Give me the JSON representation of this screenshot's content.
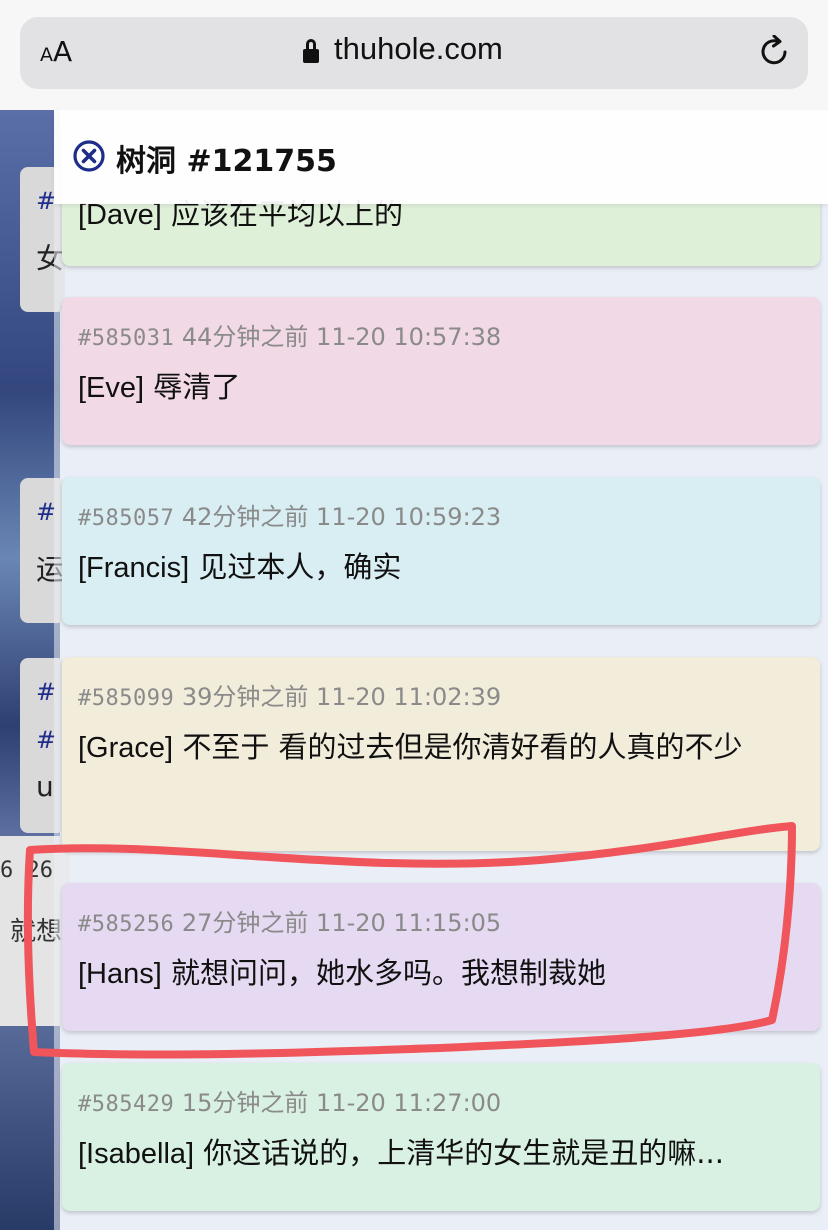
{
  "browser": {
    "text_size_label": "AA",
    "url": "thuhole.com"
  },
  "background_fragments": {
    "items": [
      "#",
      "女",
      "#",
      "运",
      "#",
      "#",
      "u",
      "6 26",
      "就想"
    ]
  },
  "panel": {
    "title": "树洞 #121755"
  },
  "replies": [
    {
      "id": "",
      "time_ago": "",
      "timestamp": "",
      "author": "[Dave]",
      "content": "应该在平均以上的",
      "color": "#dff0d9"
    },
    {
      "id": "#585031",
      "time_ago": "44分钟之前",
      "timestamp": "11-20 10:57:38",
      "author": "[Eve]",
      "content": "辱清了",
      "color": "#f1d9e6"
    },
    {
      "id": "#585057",
      "time_ago": "42分钟之前",
      "timestamp": "11-20 10:59:23",
      "author": "[Francis]",
      "content": "见过本人，确实",
      "color": "#d8eef2"
    },
    {
      "id": "#585099",
      "time_ago": "39分钟之前",
      "timestamp": "11-20 11:02:39",
      "author": "[Grace]",
      "content": "不至于 看的过去但是你清好看的人真的不少",
      "color": "#f2ecda"
    },
    {
      "id": "#585256",
      "time_ago": "27分钟之前",
      "timestamp": "11-20 11:15:05",
      "author": "[Hans]",
      "content": "就想问问，她水多吗。我想制裁她",
      "color": "#e6d9f2"
    },
    {
      "id": "#585429",
      "time_ago": "15分钟之前",
      "timestamp": "11-20 11:27:00",
      "author": "[Isabella]",
      "content": "你这话说的，上清华的女生就是丑的嘛...",
      "color": "#d9f1e2"
    }
  ],
  "colors": {
    "highlight_stroke": "#f0555c",
    "close_icon": "#1f2d8a"
  }
}
